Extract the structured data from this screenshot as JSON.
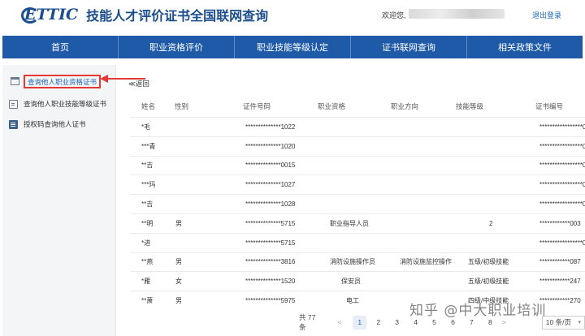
{
  "header": {
    "logo_text": "ETTIC",
    "title": "技能人才评价证书全国联网查询",
    "welcome": "欢迎您,",
    "logout": "退出登录"
  },
  "nav": [
    "首页",
    "职业资格评价",
    "职业技能等级认定",
    "证书联网查询",
    "相关政策文件"
  ],
  "sidebar": {
    "items": [
      {
        "label": "查询他人职业资格证书",
        "icon": "folder-icon"
      },
      {
        "label": "查询他人职业技能等级证书",
        "icon": "certificate-icon"
      },
      {
        "label": "授权码查询他人证书",
        "icon": "document-icon"
      }
    ]
  },
  "main": {
    "back": "≪返回",
    "columns": [
      "姓名",
      "性别",
      "证件号码",
      "职业资格",
      "职业方向",
      "技能等级",
      "证书编号"
    ],
    "rows": [
      [
        "*毛",
        "",
        "**************1022",
        "",
        "",
        "",
        "*****************0"
      ],
      [
        "***青",
        "",
        "**************1020",
        "",
        "",
        "",
        "*****************0"
      ],
      [
        "**吉",
        "",
        "**************0015",
        "",
        "",
        "",
        "*****************0"
      ],
      [
        "***玛",
        "",
        "**************1027",
        "",
        "",
        "",
        "*****************0"
      ],
      [
        "**吉",
        "",
        "**************1028",
        "",
        "",
        "",
        "*****************0"
      ],
      [
        "**明",
        "男",
        "**************5715",
        "职业指导人员",
        "",
        "2",
        "************003"
      ],
      [
        "*进",
        "",
        "**************5715",
        "",
        "",
        "",
        "*****************0"
      ],
      [
        "**燕",
        "男",
        "**************3816",
        "消防设施操作员",
        "消防设施监控操作",
        "五级/初级技能",
        "************087"
      ],
      [
        "*雁",
        "女",
        "**************1520",
        "保安员",
        "",
        "五级/初级技能",
        "************247"
      ],
      [
        "**萧",
        "男",
        "**************5975",
        "电工",
        "",
        "四级/中级技能",
        "************270"
      ]
    ]
  },
  "pagination": {
    "total": "共 77 条",
    "prev": "<",
    "pages": [
      "1",
      "2",
      "3",
      "4",
      "5",
      "6",
      "7",
      "8"
    ],
    "current": "1",
    "next": ">",
    "page_size": "10 条/页"
  },
  "watermark": "知乎 @中大职业培训",
  "colors": {
    "nav_bg": "#1e5aa8",
    "brand": "#1b4d8f",
    "highlight_border": "#e53935",
    "link": "#1b64b8"
  }
}
